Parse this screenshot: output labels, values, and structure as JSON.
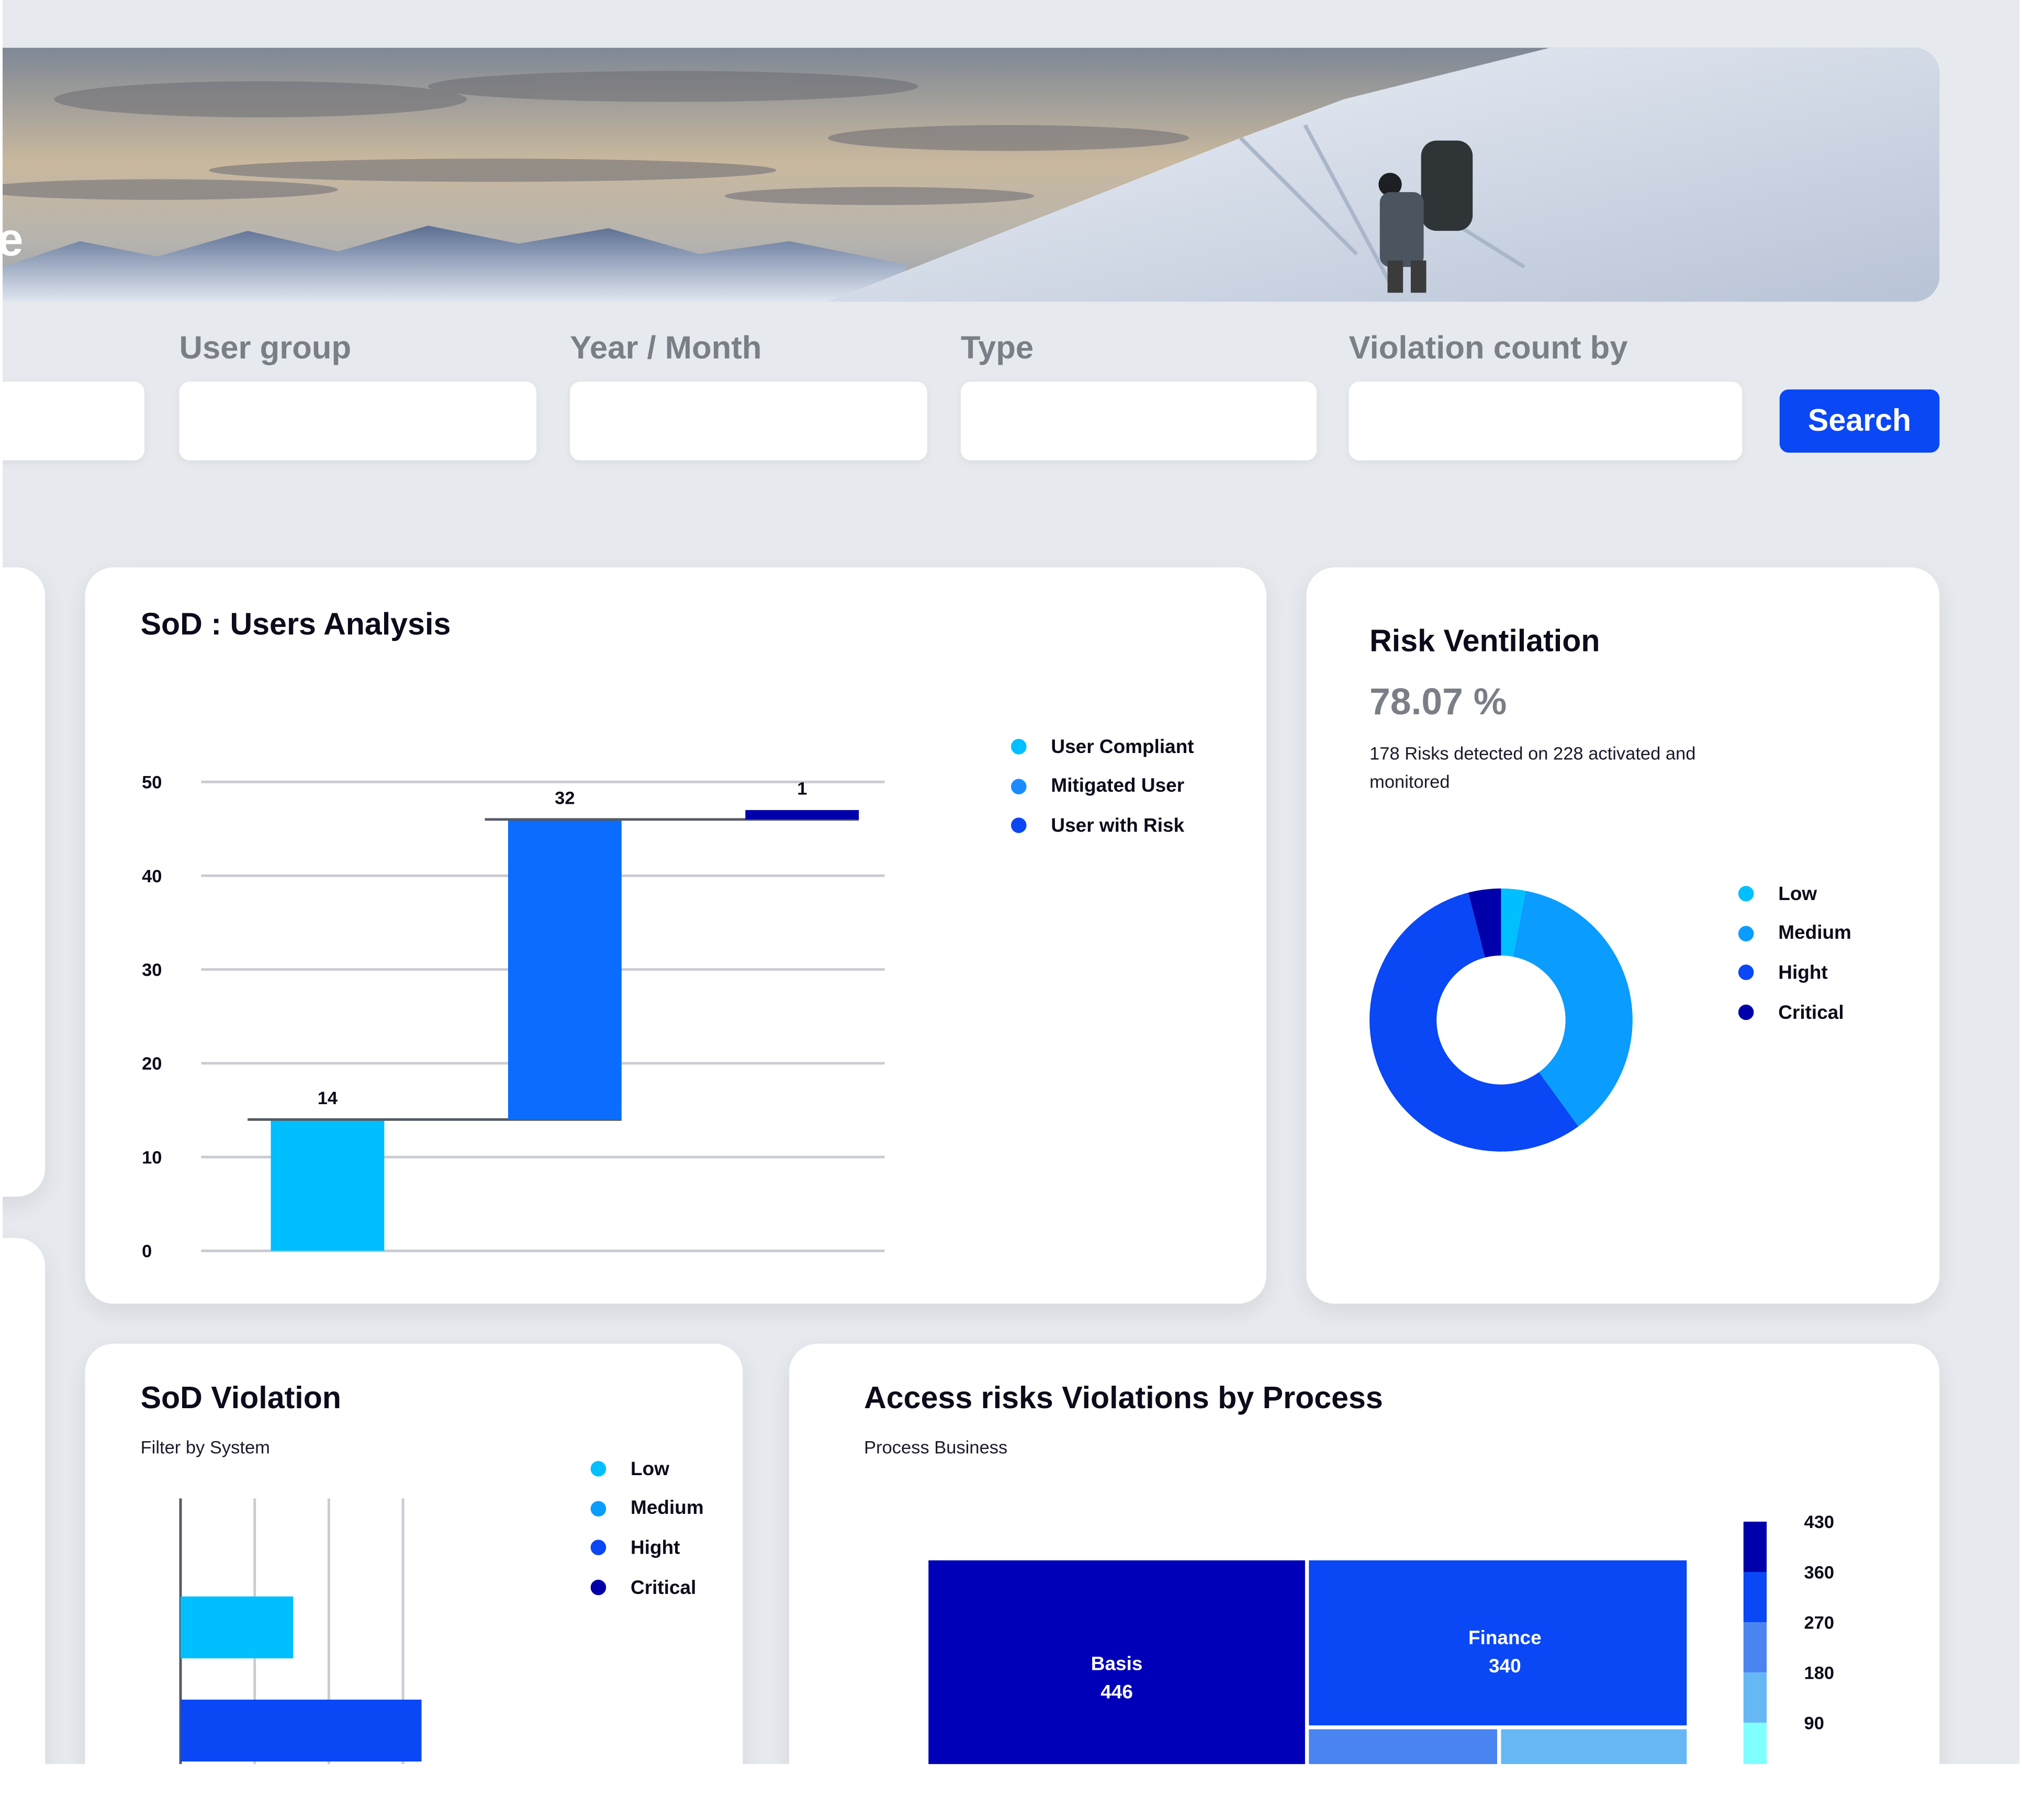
{
  "hero": {
    "title": "e"
  },
  "filters": {
    "fields": [
      {
        "label": "",
        "value": ""
      },
      {
        "label": "User group",
        "value": ""
      },
      {
        "label": "Year / Month",
        "value": ""
      },
      {
        "label": "Type",
        "value": ""
      },
      {
        "label": "Violation count by",
        "value": ""
      }
    ],
    "search_label": "Search",
    "button_color": "#0a47f5"
  },
  "users_analysis": {
    "title": "SoD : Users Analysis",
    "legend": [
      {
        "name": "User Compliant",
        "color": "#00bfff"
      },
      {
        "name": "Mitigated User",
        "color": "#1a8cff"
      },
      {
        "name": "User with Risk",
        "color": "#0a47f5"
      }
    ]
  },
  "risk_ventilation": {
    "title": "Risk Ventilation",
    "percent": "78.07 %",
    "description_line1": "178 Risks detected on 228 activated and",
    "description_line2": "monitored",
    "legend": [
      {
        "name": "Low",
        "color": "#00bfff"
      },
      {
        "name": "Medium",
        "color": "#0a9cff"
      },
      {
        "name": "Hight",
        "color": "#0a47f5"
      },
      {
        "name": "Critical",
        "color": "#0000aa"
      }
    ]
  },
  "sod_violation": {
    "title": "SoD Violation",
    "subtitle": "Filter by System",
    "legend": [
      {
        "name": "Low",
        "color": "#00bfff"
      },
      {
        "name": "Medium",
        "color": "#0a9cff"
      },
      {
        "name": "Hight",
        "color": "#0a47f5"
      },
      {
        "name": "Critical",
        "color": "#0000aa"
      }
    ]
  },
  "access_risks": {
    "title": "Access risks Violations by Process",
    "subtitle": "Process Business"
  },
  "chart_data": [
    {
      "type": "bar",
      "subtype": "waterfall",
      "title": "SoD : Users Analysis",
      "categories": [
        "User Compliant",
        "Mitigated User",
        "User with Risk"
      ],
      "values": [
        14,
        32,
        1
      ],
      "data_labels": [
        "14",
        "32",
        "1"
      ],
      "colors": [
        "#00bfff",
        "#0a6dff",
        "#0000aa"
      ],
      "y_ticks": [
        0,
        10,
        20,
        30,
        40,
        50
      ],
      "ylim": [
        0,
        55
      ],
      "grid": true,
      "legend_position": "right"
    },
    {
      "type": "pie",
      "subtype": "donut",
      "title": "Risk Ventilation",
      "labels": [
        "Low",
        "Medium",
        "Hight",
        "Critical"
      ],
      "values": [
        3,
        37,
        56,
        4
      ],
      "colors": [
        "#00bfff",
        "#0a9cff",
        "#0a47f5",
        "#0000aa"
      ],
      "legend_position": "right"
    },
    {
      "type": "bar",
      "orientation": "horizontal",
      "title": "SoD Violation",
      "categories": [
        "Low",
        "Hight"
      ],
      "values": [
        1.52,
        3.25
      ],
      "colors": [
        "#00bfff",
        "#0a47f5"
      ],
      "xlim": [
        0,
        4
      ],
      "grid": true,
      "legend_position": "right"
    },
    {
      "type": "heatmap",
      "subtype": "treemap",
      "title": "Access risks Violations by Process",
      "labels": [
        "Basis",
        "Finance"
      ],
      "values": [
        446,
        340
      ],
      "colors": [
        "#0000b8",
        "#0a47f5"
      ],
      "colorbar_ticks": [
        430,
        360,
        270,
        180,
        90
      ],
      "colorbar_colors": [
        "#0000aa",
        "#0a47f5",
        "#4a84f0",
        "#66b8f5",
        "#80ffff"
      ]
    }
  ]
}
